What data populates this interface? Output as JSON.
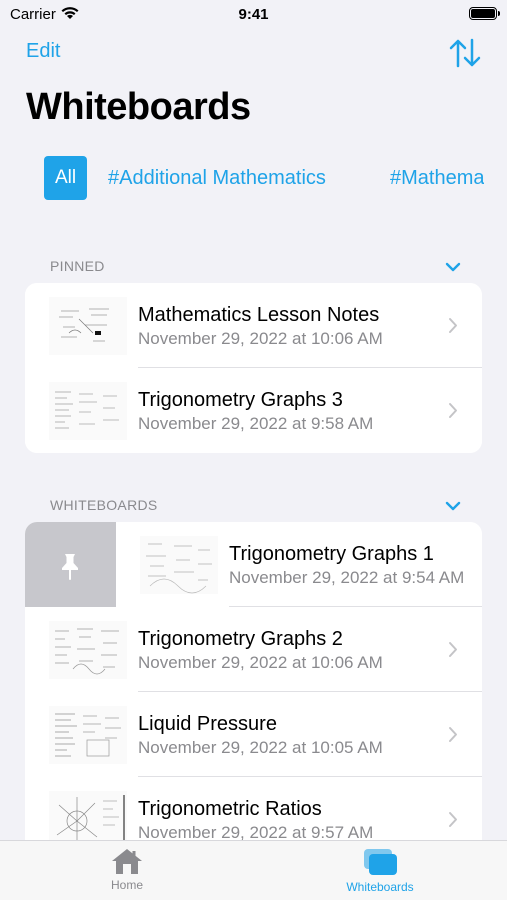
{
  "status": {
    "carrier": "Carrier",
    "time": "9:41"
  },
  "nav": {
    "edit_label": "Edit",
    "sort_icon": "sort-arrows-icon"
  },
  "title": "Whiteboards",
  "tags": {
    "all": "All",
    "items": [
      "#Additional Mathematics",
      "#Mathematics"
    ]
  },
  "pinned": {
    "header": "PINNED",
    "rows": [
      {
        "title": "Mathematics Lesson Notes",
        "date": "November 29, 2022 at 10:06 AM"
      },
      {
        "title": "Trigonometry Graphs 3",
        "date": "November 29, 2022 at 9:58 AM"
      }
    ]
  },
  "whiteboards": {
    "header": "WHITEBOARDS",
    "swiped_row": {
      "title": "Trigonometry Graphs 1",
      "date": "November 29, 2022 at 9:54 AM",
      "action_icon": "pin-icon"
    },
    "rows": [
      {
        "title": "Trigonometry Graphs 2",
        "date": "November 29, 2022 at 10:06 AM"
      },
      {
        "title": "Liquid Pressure",
        "date": "November 29, 2022 at 10:05 AM"
      },
      {
        "title": "Trigonometric Ratios",
        "date": "November 29, 2022 at 9:57 AM"
      }
    ]
  },
  "tabbar": {
    "home": "Home",
    "whiteboards": "Whiteboards"
  },
  "colors": {
    "accent": "#1fa3e8",
    "background": "#f2f2f7",
    "secondary_text": "#8a8a8e",
    "swipe_action": "#c7c7cc"
  }
}
